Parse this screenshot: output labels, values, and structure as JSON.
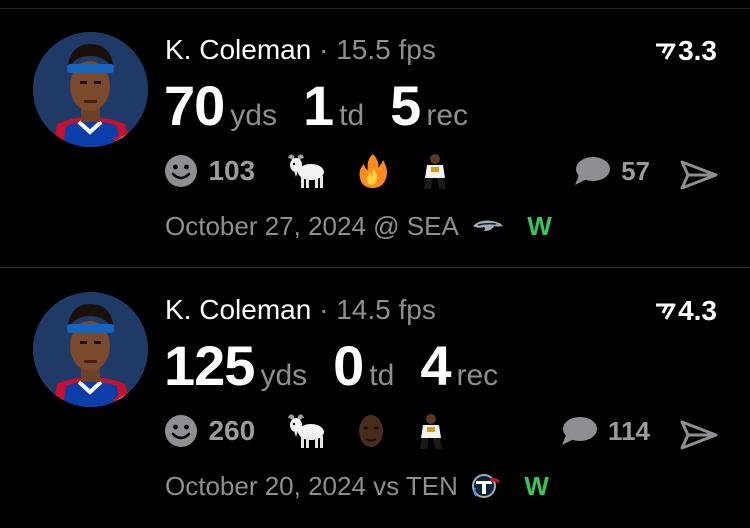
{
  "feed": {
    "posts": [
      {
        "player_name": "K. Coleman",
        "separator": "·",
        "fps": "15.5 fps",
        "trend_value": "3.3",
        "stats": [
          {
            "value": "70",
            "unit": "yds"
          },
          {
            "value": "1",
            "unit": "td"
          },
          {
            "value": "5",
            "unit": "rec"
          }
        ],
        "reaction_count": "103",
        "reaction_emojis": [
          "goat-icon",
          "fire-icon",
          "player-sticker"
        ],
        "comment_count": "57",
        "game_date": "October 27, 2024",
        "matchup": "@ SEA",
        "opponent_logo": "seahawks-logo",
        "result": "W",
        "result_color": "#34c759"
      },
      {
        "player_name": "K. Coleman",
        "separator": "·",
        "fps": "14.5 fps",
        "trend_value": "4.3",
        "stats": [
          {
            "value": "125",
            "unit": "yds"
          },
          {
            "value": "0",
            "unit": "td"
          },
          {
            "value": "4",
            "unit": "rec"
          }
        ],
        "reaction_count": "260",
        "reaction_emojis": [
          "goat-icon",
          "face-sticker",
          "player-sticker"
        ],
        "comment_count": "114",
        "game_date": "October 20, 2024",
        "matchup": "vs TEN",
        "opponent_logo": "titans-logo",
        "result": "W",
        "result_color": "#34c759"
      }
    ]
  },
  "colors": {
    "background": "#000000",
    "muted_text": "#8e8e93",
    "avatar_bg": "#1f3a66",
    "win": "#34c759"
  }
}
